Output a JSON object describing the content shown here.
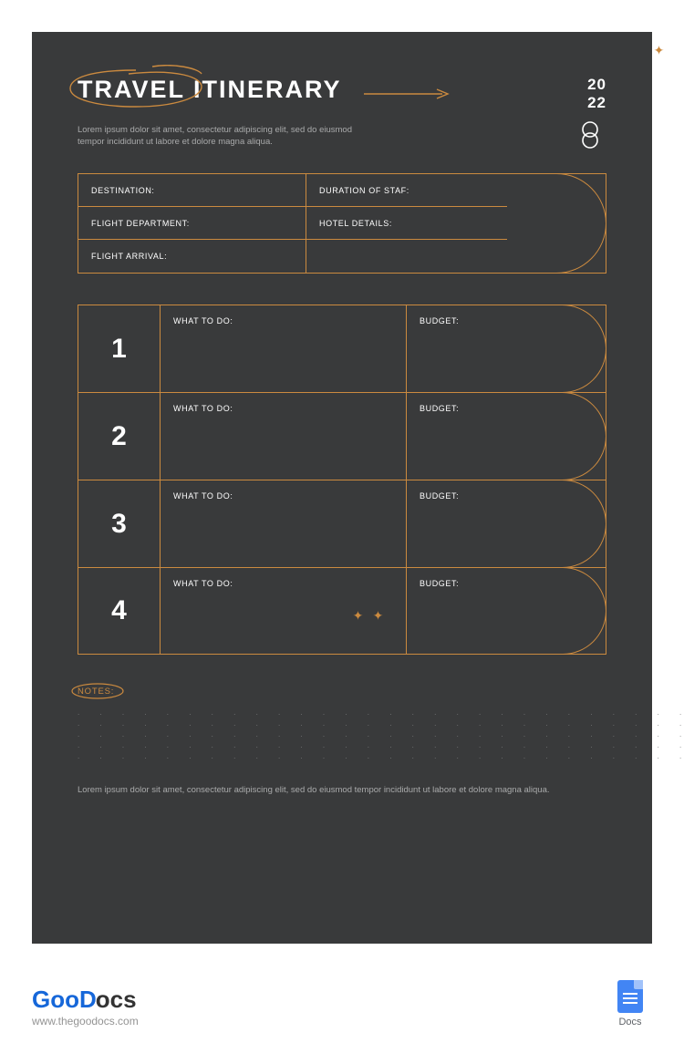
{
  "header": {
    "title": "TRAVEL ITINERARY",
    "year_top": "20",
    "year_bottom": "22"
  },
  "intro": "Lorem ipsum dolor sit amet, consectetur adipiscing elit, sed do eiusmod tempor incididunt ut labore et dolore magna aliqua.",
  "info": {
    "destination": "DESTINATION:",
    "duration": "DURATION OF STAF:",
    "flight_dep": "FLIGHT DEPARTMENT:",
    "hotel": "HOTEL DETAILS:",
    "flight_arr": "FLIGHT ARRIVAL:"
  },
  "days": [
    {
      "num": "1",
      "what": "WHAT TO DO:",
      "budget": "BUDGET:"
    },
    {
      "num": "2",
      "what": "WHAT TO DO:",
      "budget": "BUDGET:"
    },
    {
      "num": "3",
      "what": "WHAT TO DO:",
      "budget": "BUDGET:"
    },
    {
      "num": "4",
      "what": "WHAT TO DO:",
      "budget": "BUDGET:"
    }
  ],
  "notes_label": "NOTES:",
  "footer": "Lorem ipsum dolor sit amet, consectetur adipiscing elit, sed do eiusmod tempor incididunt ut labore et dolore magna aliqua.",
  "brand": {
    "goo": "Goo",
    "d": "D",
    "ocs": "ocs",
    "url": "www.thegoodocs.com",
    "docs": "Docs"
  },
  "colors": {
    "accent": "#cb8a3f",
    "bg": "#393a3b"
  }
}
